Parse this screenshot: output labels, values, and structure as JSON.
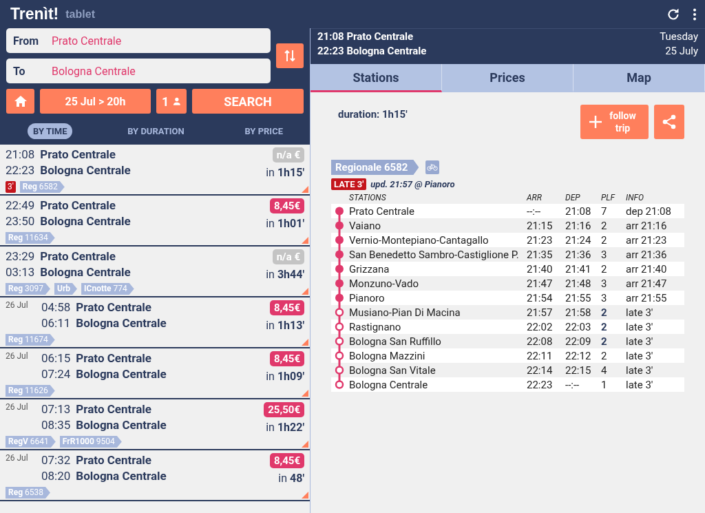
{
  "app": {
    "title": "Trenìt!",
    "subtitle": "tablet"
  },
  "search": {
    "from_label": "From",
    "from_value": "Prato Centrale",
    "to_label": "To",
    "to_value": "Bologna Centrale",
    "date": "25 Jul > 20h",
    "passengers": "1",
    "search_button": "SEARCH"
  },
  "sort_tabs": [
    {
      "label": "BY TIME",
      "selected": true
    },
    {
      "label": "BY DURATION",
      "selected": false
    },
    {
      "label": "BY PRICE",
      "selected": false
    }
  ],
  "results": [
    {
      "dep": "21:08",
      "from": "Prato Centrale",
      "arr": "22:23",
      "to": "Bologna Centrale",
      "price": "n/a €",
      "price_available": false,
      "duration": "in **1h15'**",
      "delay": "3'",
      "trains": [
        "**Reg** 6582"
      ]
    },
    {
      "dep": "22:49",
      "from": "Prato Centrale",
      "arr": "23:50",
      "to": "Bologna Centrale",
      "price": "8,45€",
      "price_available": true,
      "duration": "in **1h01'**",
      "trains": [
        "**Reg** 11634"
      ]
    },
    {
      "dep": "23:29",
      "from": "Prato Centrale",
      "arr": "03:13",
      "to": "Bologna Centrale",
      "price": "n/a €",
      "price_available": false,
      "duration": "in **3h44'**",
      "trains": [
        "**Reg** 3097",
        "**Urb**",
        "**ICnotte** 774"
      ]
    },
    {
      "date": "26 Jul",
      "dep": "04:58",
      "from": "Prato Centrale",
      "arr": "06:11",
      "to": "Bologna Centrale",
      "price": "8,45€",
      "price_available": true,
      "duration": "in **1h13'**",
      "trains": [
        "**Reg** 11674"
      ]
    },
    {
      "date": "26 Jul",
      "dep": "06:15",
      "from": "Prato Centrale",
      "arr": "07:24",
      "to": "Bologna Centrale",
      "price": "8,45€",
      "price_available": true,
      "duration": "in **1h09'**",
      "trains": [
        "**Reg** 11626"
      ]
    },
    {
      "date": "26 Jul",
      "dep": "07:13",
      "from": "Prato Centrale",
      "arr": "08:35",
      "to": "Bologna Centrale",
      "price": "25,50€",
      "price_available": true,
      "duration": "in **1h22'**",
      "trains": [
        "**RegV** 6641",
        "**FrR1000** 9504"
      ]
    },
    {
      "date": "26 Jul",
      "dep": "07:32",
      "from": "Prato Centrale",
      "arr": "08:20",
      "to": "Bologna Centrale",
      "price": "8,45€",
      "price_available": true,
      "duration": "in **48'**",
      "trains": [
        "**Reg** 6538"
      ]
    }
  ],
  "detail": {
    "dep_line": "21:08 Prato Centrale",
    "arr_line": "22:23 Bologna Centrale",
    "weekday": "Tuesday",
    "day": "25 July",
    "tabs": [
      {
        "label": "Stations",
        "selected": true
      },
      {
        "label": "Prices",
        "selected": false
      },
      {
        "label": "Map",
        "selected": false
      }
    ],
    "duration": "duration: 1h15'",
    "follow_button": "follow trip",
    "train": "Regionale 6582",
    "late_badge": "LATE 3'",
    "update": "upd. 21:57 @ Pianoro",
    "columns": [
      "STATIONS",
      "ARR",
      "DEP",
      "PLF",
      "INFO"
    ],
    "stops": [
      {
        "name": "Prato Centrale",
        "arr": "--:--",
        "dep": "21:08",
        "plf": "7",
        "info": "dep 21:08",
        "passed": true,
        "plf_highlight": false
      },
      {
        "name": "Vaiano",
        "arr": "21:15",
        "dep": "21:16",
        "plf": "2",
        "info": "arr 21:16",
        "passed": true,
        "plf_highlight": false
      },
      {
        "name": "Vernio-Montepiano-Cantagallo",
        "arr": "21:23",
        "dep": "21:24",
        "plf": "2",
        "info": "arr 21:23",
        "passed": true,
        "plf_highlight": false
      },
      {
        "name": "San Benedetto Sambro-Castiglione P.",
        "arr": "21:35",
        "dep": "21:36",
        "plf": "3",
        "info": "arr 21:36",
        "passed": true,
        "plf_highlight": false
      },
      {
        "name": "Grizzana",
        "arr": "21:40",
        "dep": "21:41",
        "plf": "2",
        "info": "arr 21:40",
        "passed": true,
        "plf_highlight": false
      },
      {
        "name": "Monzuno-Vado",
        "arr": "21:47",
        "dep": "21:48",
        "plf": "3",
        "info": "arr 21:47",
        "passed": true,
        "plf_highlight": false
      },
      {
        "name": "Pianoro",
        "arr": "21:54",
        "dep": "21:55",
        "plf": "3",
        "info": "arr 21:55",
        "passed": true,
        "plf_highlight": false
      },
      {
        "name": "Musiano-Pian Di Macina",
        "arr": "21:57",
        "dep": "21:58",
        "plf": "2",
        "info": "late 3'",
        "passed": false,
        "plf_highlight": true
      },
      {
        "name": "Rastignano",
        "arr": "22:02",
        "dep": "22:03",
        "plf": "2",
        "info": "late 3'",
        "passed": false,
        "plf_highlight": true
      },
      {
        "name": "Bologna San Ruffillo",
        "arr": "22:08",
        "dep": "22:09",
        "plf": "2",
        "info": "late 3'",
        "passed": false,
        "plf_highlight": true
      },
      {
        "name": "Bologna Mazzini",
        "arr": "22:11",
        "dep": "22:12",
        "plf": "2",
        "info": "late 3'",
        "passed": false,
        "plf_highlight": false
      },
      {
        "name": "Bologna San Vitale",
        "arr": "22:14",
        "dep": "22:15",
        "plf": "4",
        "info": "late 3'",
        "passed": false,
        "plf_highlight": false
      },
      {
        "name": "Bologna Centrale",
        "arr": "22:23",
        "dep": "--:--",
        "plf": "1",
        "info": "late 3'",
        "passed": false,
        "plf_highlight": false
      }
    ]
  }
}
